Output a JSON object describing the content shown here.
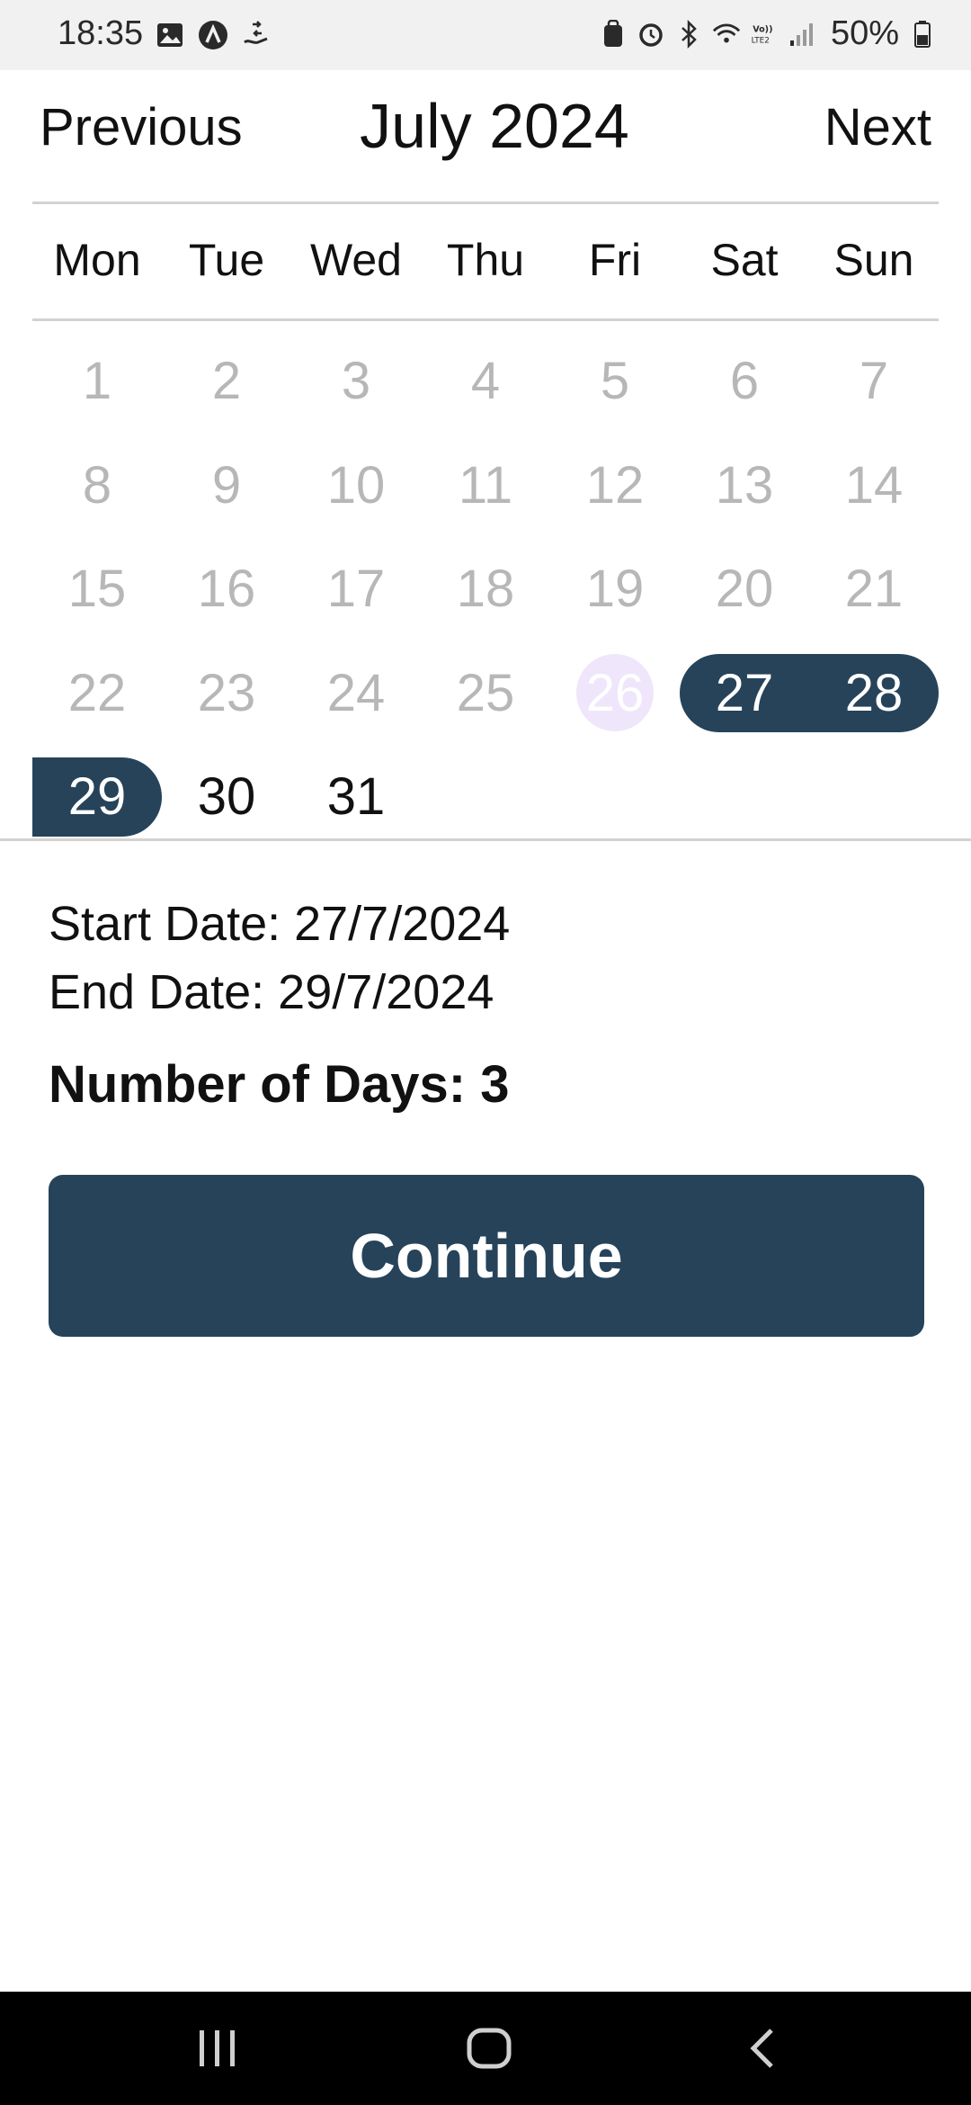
{
  "status_bar": {
    "time": "18:35",
    "battery": "50%",
    "left_icons": [
      "gallery-icon",
      "app-a-icon",
      "hand-share-icon"
    ],
    "right_icons": [
      "security-icon",
      "alarm-icon",
      "bluetooth-icon",
      "wifi-icon",
      "volte-icon",
      "signal-icon",
      "battery-icon"
    ]
  },
  "calendar": {
    "prev_label": "Previous",
    "next_label": "Next",
    "month_title": "July 2024",
    "weekdays": [
      "Mon",
      "Tue",
      "Wed",
      "Thu",
      "Fri",
      "Sat",
      "Sun"
    ],
    "days": [
      "1",
      "2",
      "3",
      "4",
      "5",
      "6",
      "7",
      "8",
      "9",
      "10",
      "11",
      "12",
      "13",
      "14",
      "15",
      "16",
      "17",
      "18",
      "19",
      "20",
      "21",
      "22",
      "23",
      "24",
      "25",
      "26",
      "27",
      "28",
      "29",
      "30",
      "31"
    ],
    "today": "26",
    "selected": [
      "27",
      "28",
      "29"
    ],
    "accent": "#26435a",
    "today_bg": "#efe6fb"
  },
  "summary": {
    "start_date": "Start Date: 27/7/2024",
    "end_date": "End Date: 29/7/2024",
    "days": "Number of Days: 3"
  },
  "actions": {
    "continue_label": "Continue"
  }
}
